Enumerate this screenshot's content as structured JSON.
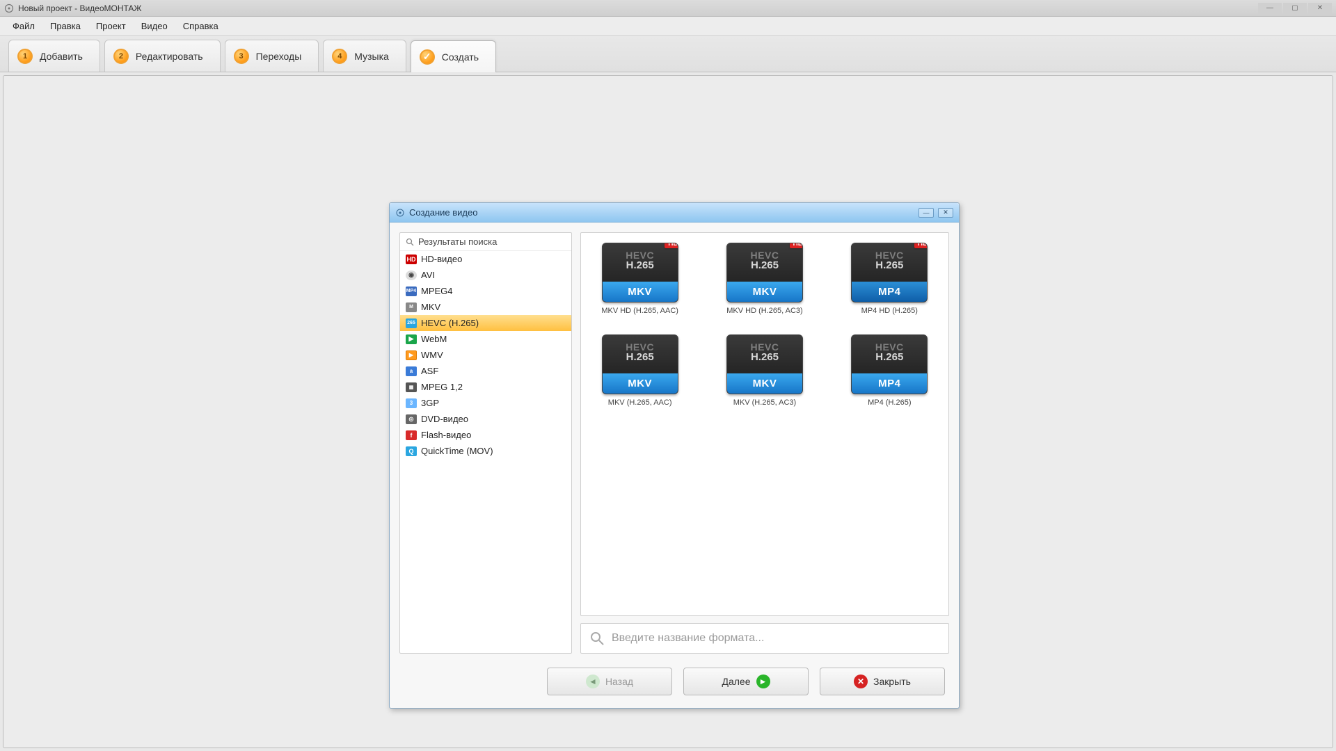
{
  "window": {
    "title": "Новый проект - ВидеоМОНТАЖ"
  },
  "menu": {
    "file": "Файл",
    "edit": "Правка",
    "project": "Проект",
    "video": "Видео",
    "help": "Справка"
  },
  "tabs": {
    "add_num": "1",
    "add": "Добавить",
    "edit_num": "2",
    "edit_label": "Редактировать",
    "trans_num": "3",
    "transitions": "Переходы",
    "music_num": "4",
    "music": "Музыка",
    "create": "Создать"
  },
  "dialog": {
    "title": "Создание видео",
    "search_results": "Результаты поиска",
    "search_placeholder": "Введите название формата...",
    "back": "Назад",
    "next": "Далее",
    "close": "Закрыть"
  },
  "sidebar": {
    "hd": "HD-видео",
    "avi": "AVI",
    "mpeg4": "MPEG4",
    "mkv": "MKV",
    "hevc": "HEVC (H.265)",
    "webm": "WebM",
    "wmv": "WMV",
    "asf": "ASF",
    "mpeg12": "MPEG 1,2",
    "gp3": "3GP",
    "dvd": "DVD-видео",
    "flash": "Flash-видео",
    "qt": "QuickTime (MOV)"
  },
  "formats": {
    "codec_top": "HEVC",
    "codec_bot": "H.265",
    "hd_badge": "HD",
    "items": [
      {
        "band": "MKV",
        "label": "MKV HD (H.265, AAC)",
        "hd": true
      },
      {
        "band": "MKV",
        "label": "MKV HD (H.265, AC3)",
        "hd": true
      },
      {
        "band": "MP4",
        "label": "MP4 HD (H.265)",
        "hd": true,
        "selected": true
      },
      {
        "band": "MKV",
        "label": "MKV (H.265, AAC)",
        "hd": false
      },
      {
        "band": "MKV",
        "label": "MKV (H.265, AC3)",
        "hd": false
      },
      {
        "band": "MP4",
        "label": "MP4 (H.265)",
        "hd": false
      }
    ]
  }
}
